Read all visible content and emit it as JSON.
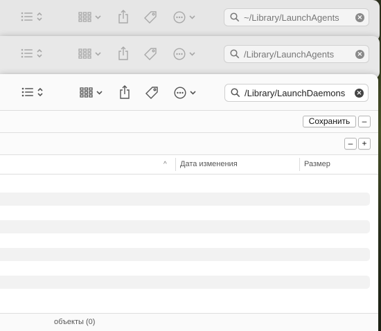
{
  "windows": [
    {
      "search": {
        "value": "~/Library/LaunchAgents"
      }
    },
    {
      "search": {
        "value": "/Library/LaunchAgents"
      }
    },
    {
      "search": {
        "value": "/Library/LaunchDaemons"
      }
    }
  ],
  "toolbar": {
    "view_icon": "list-view-icon",
    "group_icon": "grid-group-icon",
    "share_icon": "share-icon",
    "tag_icon": "tag-icon",
    "more_icon": "more-actions-icon"
  },
  "search_criteria": {
    "save_label": "Сохранить",
    "remove_label": "–",
    "add_label": "+"
  },
  "columns": {
    "name_sort_indicator": "^",
    "date_modified": "Дата изменения",
    "size": "Размер"
  },
  "status_bar": {
    "text": "объекты (0)"
  }
}
